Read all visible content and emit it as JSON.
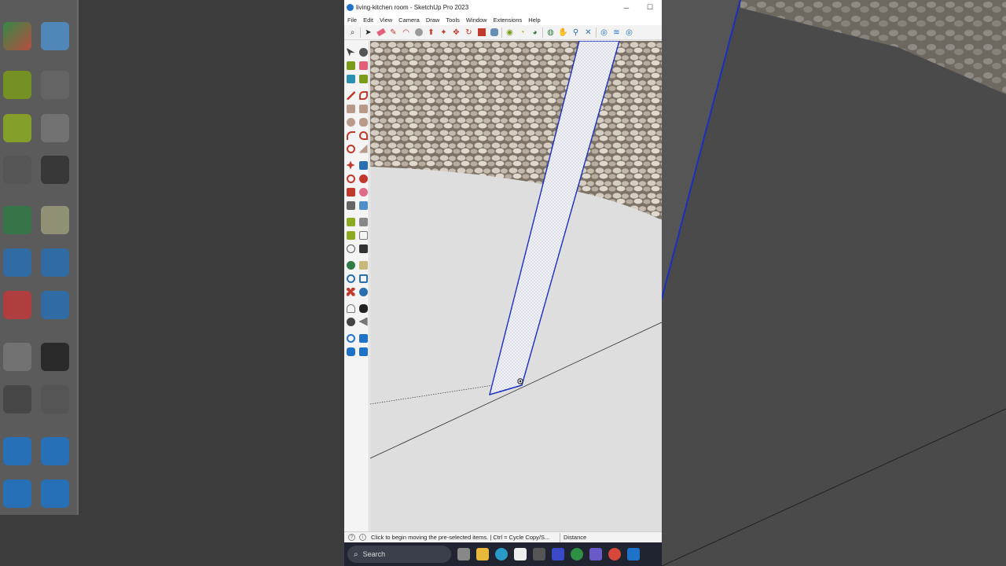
{
  "window": {
    "title": "living-kitchen room - SketchUp Pro 2023",
    "minimize": "─",
    "maximize": "☐"
  },
  "menu": [
    "File",
    "Edit",
    "View",
    "Camera",
    "Draw",
    "Tools",
    "Window",
    "Extensions",
    "Help"
  ],
  "status": {
    "message": "Click to begin moving the pre-selected items. | Ctrl = Cycle Copy/S...",
    "measurement_label": "Distance"
  },
  "taskbar": {
    "search_placeholder": "Search"
  },
  "colors": {
    "selection_blue": "#1a2fbf",
    "ground": "#dedede",
    "title_bar": "#ffffff"
  }
}
